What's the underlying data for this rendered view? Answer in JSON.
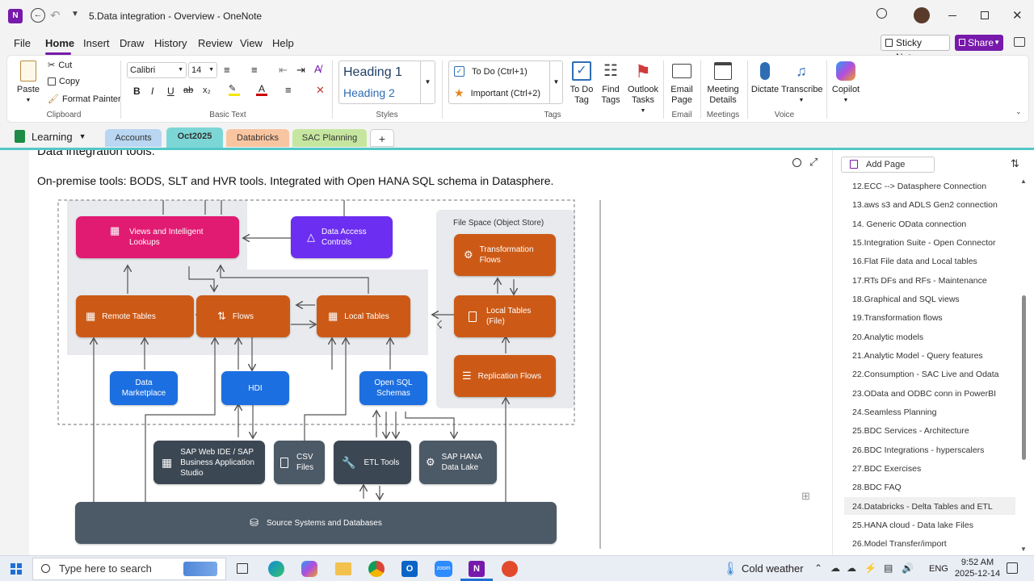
{
  "app": {
    "title": "5.Data integration - Overview - OneNote"
  },
  "menu": [
    "File",
    "Home",
    "Insert",
    "Draw",
    "History",
    "Review",
    "View",
    "Help"
  ],
  "header_buttons": {
    "sticky": "Sticky Notes",
    "share": "Share"
  },
  "ribbon": {
    "clipboard": {
      "paste": "Paste",
      "cut": "Cut",
      "copy": "Copy",
      "format_painter": "Format Painter",
      "label": "Clipboard"
    },
    "basic_text": {
      "font": "Calibri",
      "size": "14",
      "label": "Basic Text"
    },
    "styles": {
      "h1": "Heading 1",
      "h2": "Heading 2",
      "label": "Styles"
    },
    "tags": {
      "todo": "To Do (Ctrl+1)",
      "important": "Important (Ctrl+2)",
      "todo_tag": "To Do Tag",
      "find_tags": "Find Tags",
      "outlook_tasks": "Outlook Tasks",
      "label": "Tags"
    },
    "email": {
      "email_page": "Email Page",
      "label": "Email"
    },
    "meetings": {
      "details": "Meeting Details",
      "label": "Meetings"
    },
    "voice": {
      "dictate": "Dictate",
      "transcribe": "Transcribe",
      "label": "Voice"
    },
    "copilot": {
      "label": "Copilot"
    }
  },
  "notebook": {
    "name": "Learning",
    "sections": [
      "Accounts",
      "Oct2025",
      "Databricks",
      "SAC Planning"
    ],
    "add": "+"
  },
  "note": {
    "heading_partial": "Data integration tools:",
    "line": "On-premise tools: BODS, SLT and HVR tools. Integrated with Open HANA SQL schema in Datasphere."
  },
  "diagram": {
    "file_space": "File Space (Object Store)",
    "views": "Views and Intelligent Lookups",
    "dac": "Data Access Controls",
    "transformation_flows": "Transformation Flows",
    "remote_tables": "Remote Tables",
    "flows": "Flows",
    "local_tables": "Local Tables",
    "local_tables_file": "Local Tables (File)",
    "data_marketplace": "Data Marketplace",
    "hdi": "HDI",
    "open_sql": "Open SQL Schemas",
    "replication_flows": "Replication Flows",
    "web_ide": "SAP Web IDE / SAP Business Application Studio",
    "csv": "CSV Files",
    "etl": "ETL Tools",
    "hana_lake": "SAP HANA Data Lake",
    "source": "Source Systems and Databases"
  },
  "pages": {
    "add_page": "Add Page",
    "items": [
      "12.ECC --> Datasphere Connection",
      "13.aws s3 and ADLS Gen2 connection",
      "14. Generic OData connection",
      "15.Integration Suite - Open Connector",
      "16.Flat File data and Local tables",
      "17.RTs DFs and RFs - Maintenance",
      "18.Graphical and SQL views",
      "19.Transformation flows",
      "20.Analytic models",
      "21.Analytic Model - Query features",
      "22.Consumption - SAC Live and Odata",
      "23.OData and ODBC conn in PowerBI",
      "24.Seamless Planning",
      "25.BDC Services - Architecture",
      "26.BDC Integrations - hyperscalers",
      "27.BDC Exercises",
      "28.BDC FAQ",
      "24.Databricks - Delta Tables and ETL",
      "25.HANA cloud - Data lake Files",
      "26.Model Transfer/import"
    ]
  },
  "taskbar": {
    "search": "Type here to search",
    "weather": "Cold weather",
    "lang": "ENG",
    "time": "9:52 AM",
    "date": "2025-12-14"
  },
  "colors": {
    "accent": "#7719aa",
    "teal": "#52c7c7",
    "orange": "#cc5a16",
    "pink": "#e11a72",
    "purple": "#6c2ef0",
    "blue": "#1c6fe0",
    "slate": "#4c5966"
  }
}
